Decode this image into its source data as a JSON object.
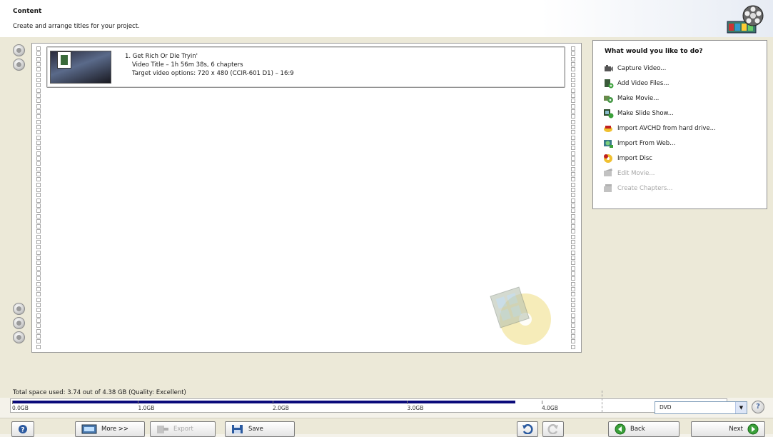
{
  "header": {
    "title": "Content",
    "subtitle": "Create and arrange titles for your project."
  },
  "title_item": {
    "line1": "1. Get Rich Or Die Tryin'",
    "line2": "Video Title – 1h 56m 38s, 6 chapters",
    "line3": "Target video options: 720 x 480 (CCIR-601 D1) – 16:9"
  },
  "actions_panel": {
    "heading": "What would you like to do?",
    "items": [
      {
        "label": "Capture Video...",
        "icon": "camera-icon",
        "enabled": true
      },
      {
        "label": "Add Video Files...",
        "icon": "add-file-icon",
        "enabled": true
      },
      {
        "label": "Make Movie...",
        "icon": "make-movie-icon",
        "enabled": true
      },
      {
        "label": "Make Slide Show...",
        "icon": "slideshow-icon",
        "enabled": true
      },
      {
        "label": "Import AVCHD from hard drive...",
        "icon": "avchd-icon",
        "enabled": true
      },
      {
        "label": "Import From Web...",
        "icon": "web-import-icon",
        "enabled": true
      },
      {
        "label": "Import Disc",
        "icon": "disc-import-icon",
        "enabled": true
      },
      {
        "label": "Edit Movie...",
        "icon": "edit-movie-icon",
        "enabled": false
      },
      {
        "label": "Create Chapters...",
        "icon": "chapters-icon",
        "enabled": false
      }
    ]
  },
  "space": {
    "label": "Total space used: 3.74 out of 4.38 GB (Quality: Excellent)",
    "used_gb": 3.74,
    "capacity_gb": 4.38,
    "scale_max_gb": 5.3,
    "ticks": [
      "0.0GB",
      "1.0GB",
      "2.0GB",
      "3.0GB",
      "4.0GB"
    ]
  },
  "disc_type": {
    "selected": "DVD"
  },
  "buttons": {
    "more": "More >>",
    "export": "Export",
    "save": "Save",
    "back": "Back",
    "next": "Next"
  },
  "colors": {
    "meter_fill": "#0a0a7a",
    "accent_green": "#3aa03a"
  }
}
